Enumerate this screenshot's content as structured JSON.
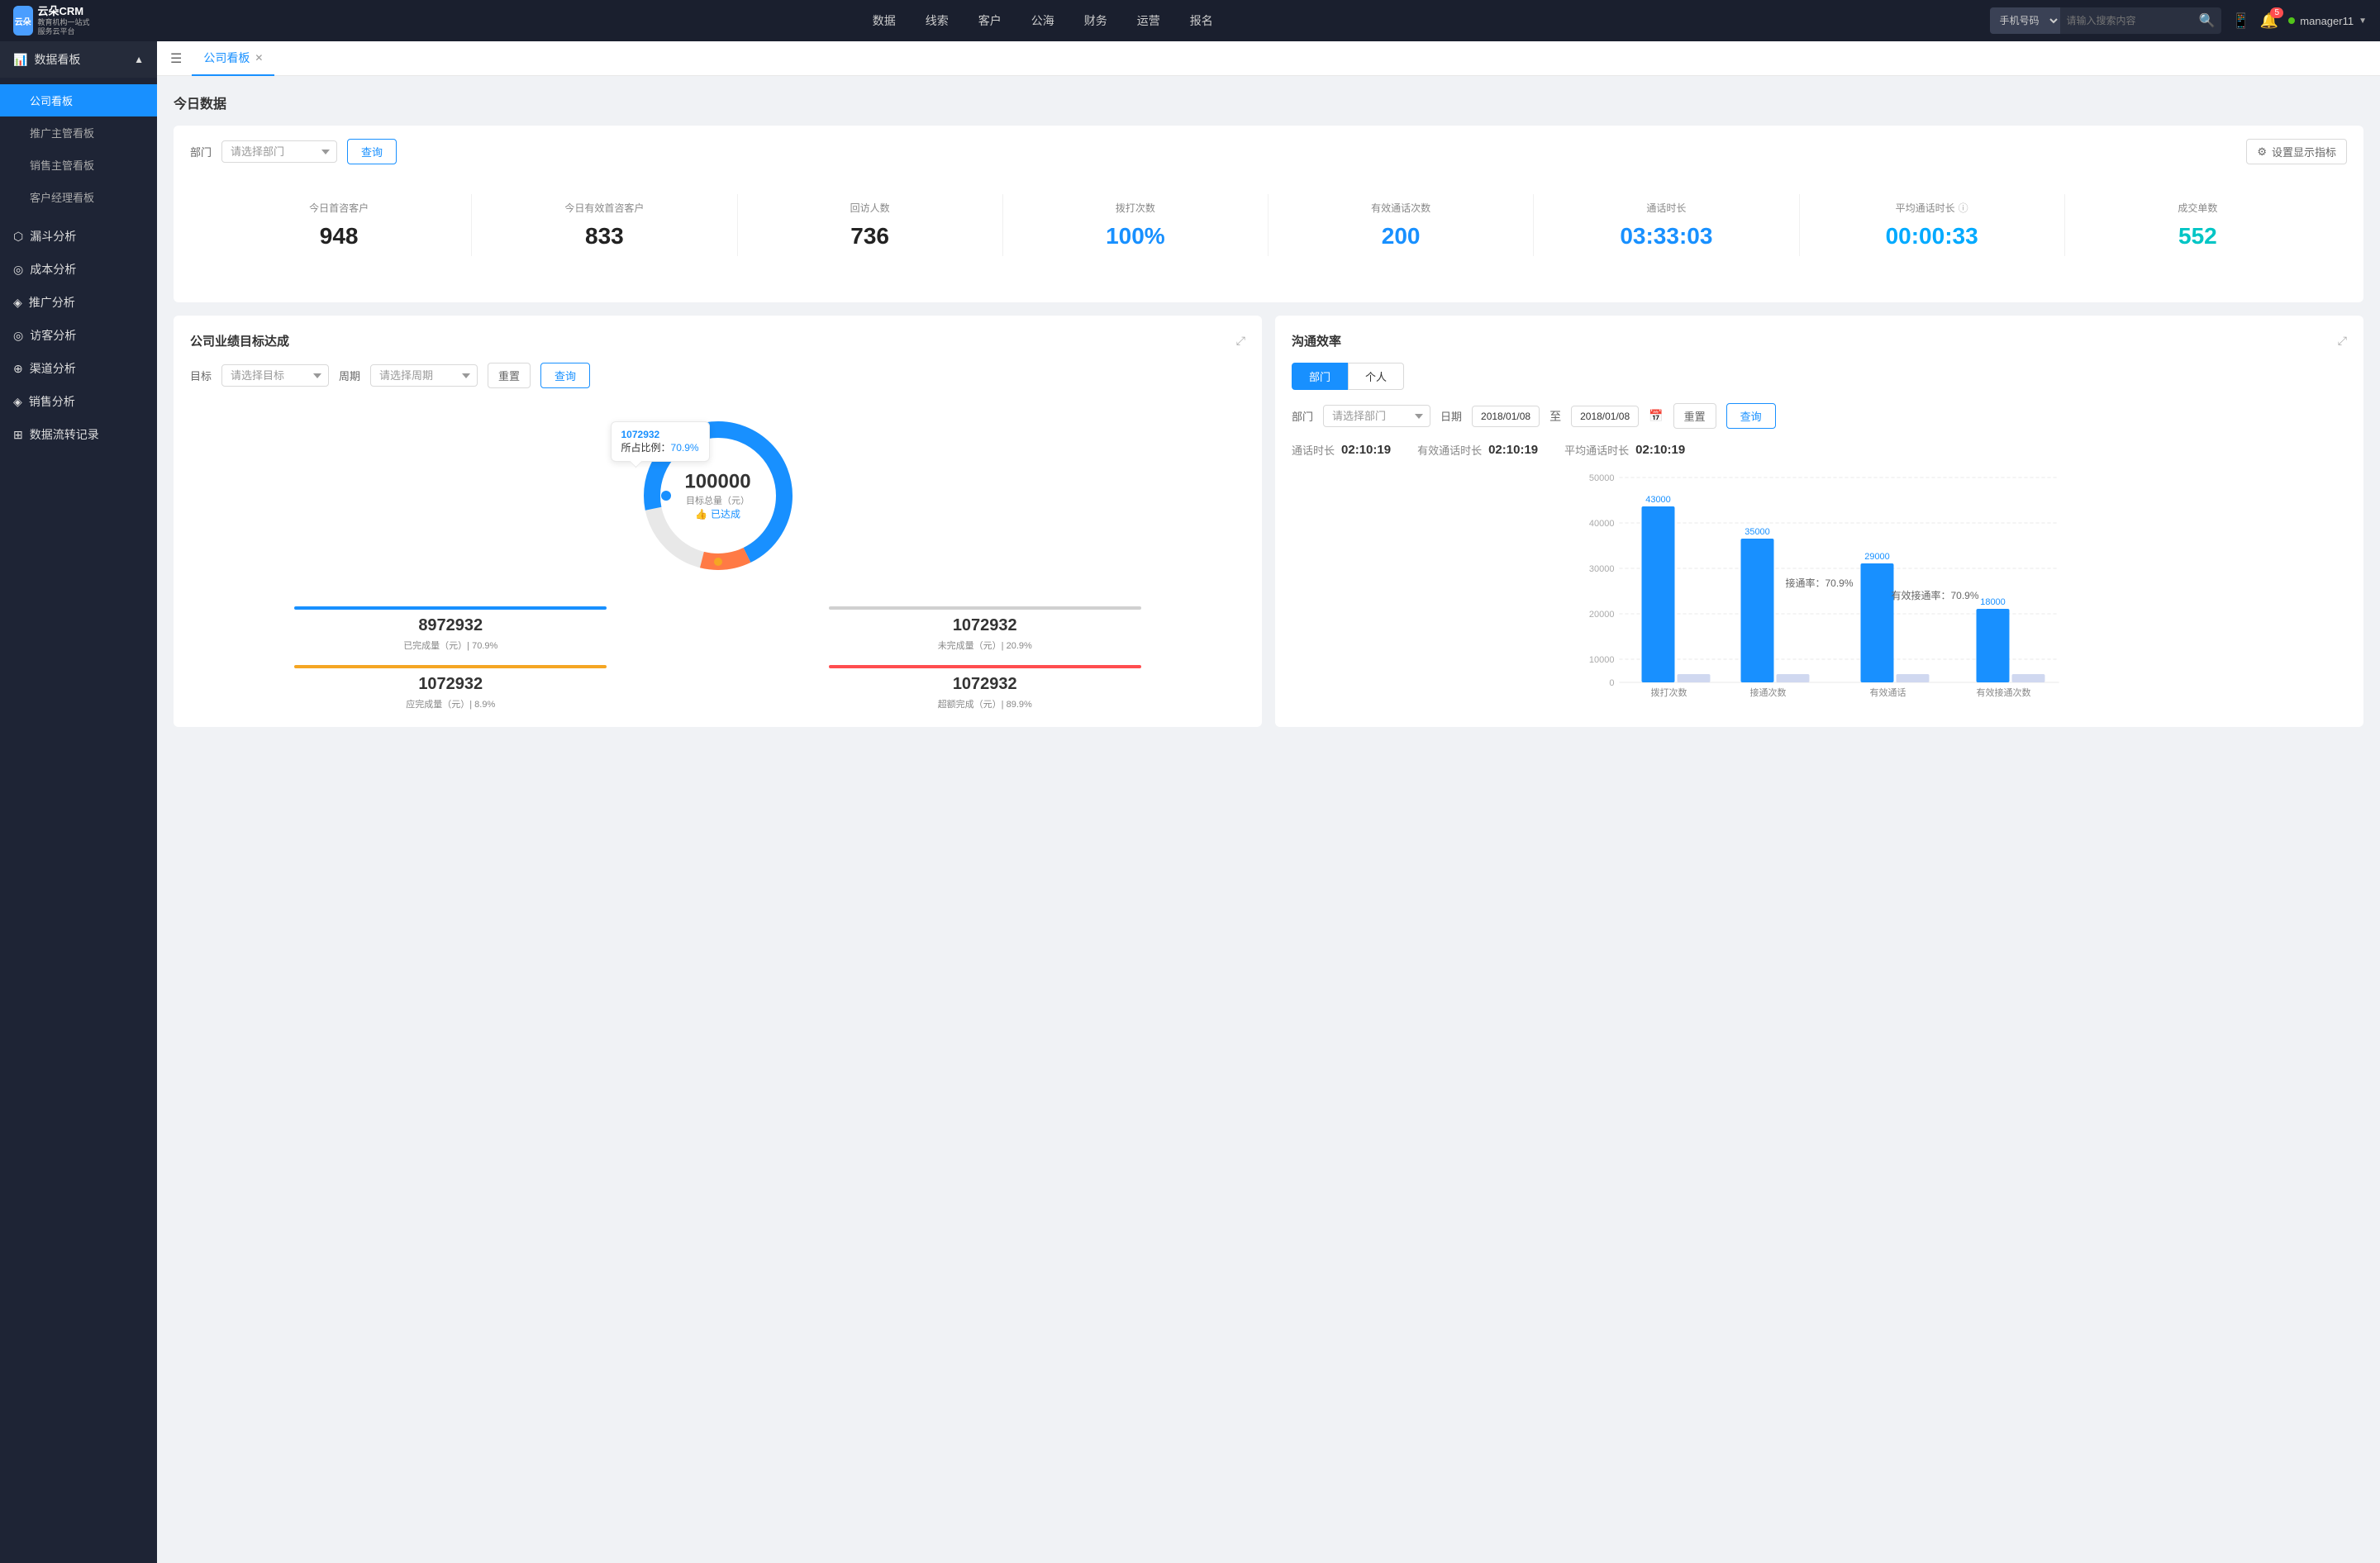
{
  "app": {
    "name": "云朵CRM",
    "subtitle": "教育机构一站式服务云平台"
  },
  "topnav": {
    "items": [
      "数据",
      "线索",
      "客户",
      "公海",
      "财务",
      "运营",
      "报名"
    ],
    "search": {
      "placeholder": "请输入搜索内容",
      "select_label": "手机号码"
    },
    "notification_count": "5",
    "username": "manager11"
  },
  "sidebar": {
    "dashboard_group": "数据看板",
    "items": [
      {
        "label": "公司看板",
        "active": true
      },
      {
        "label": "推广主管看板",
        "active": false
      },
      {
        "label": "销售主管看板",
        "active": false
      },
      {
        "label": "客户经理看板",
        "active": false
      }
    ],
    "groups": [
      {
        "label": "漏斗分析",
        "icon": "funnel"
      },
      {
        "label": "成本分析",
        "icon": "cost"
      },
      {
        "label": "推广分析",
        "icon": "promotion"
      },
      {
        "label": "访客分析",
        "icon": "visitor"
      },
      {
        "label": "渠道分析",
        "icon": "channel"
      },
      {
        "label": "销售分析",
        "icon": "sales"
      },
      {
        "label": "数据流转记录",
        "icon": "record"
      }
    ]
  },
  "tab": {
    "label": "公司看板"
  },
  "page": {
    "title": "今日数据",
    "dept_label": "部门",
    "dept_placeholder": "请选择部门",
    "query_btn": "查询",
    "settings_btn": "设置显示指标"
  },
  "stats": [
    {
      "label": "今日首咨客户",
      "value": "948",
      "color": "dark"
    },
    {
      "label": "今日有效首咨客户",
      "value": "833",
      "color": "dark"
    },
    {
      "label": "回访人数",
      "value": "736",
      "color": "dark"
    },
    {
      "label": "拨打次数",
      "value": "100%",
      "color": "blue"
    },
    {
      "label": "有效通话次数",
      "value": "200",
      "color": "blue"
    },
    {
      "label": "通话时长",
      "value": "03:33:03",
      "color": "blue"
    },
    {
      "label": "平均通话时长",
      "value": "00:00:33",
      "color": "cyan"
    },
    {
      "label": "成交单数",
      "value": "552",
      "color": "teal"
    }
  ],
  "goal_chart": {
    "title": "公司业绩目标达成",
    "target_label": "目标",
    "target_placeholder": "请选择目标",
    "period_label": "周期",
    "period_placeholder": "请选择周期",
    "reset_btn": "重置",
    "query_btn": "查询",
    "center_value": "100000",
    "center_label": "目标总量（元）",
    "achieved_label": "已达成",
    "tooltip_value": "1072932",
    "tooltip_pct_label": "所占比例：",
    "tooltip_pct": "70.9%",
    "stat_boxes": [
      {
        "bar_color": "#1890ff",
        "value": "8972932",
        "desc": "已完成量（元）| 70.9%"
      },
      {
        "bar_color": "#d0d0d0",
        "value": "1072932",
        "desc": "未完成量（元）| 20.9%"
      },
      {
        "bar_color": "#f5a623",
        "value": "1072932",
        "desc": "应完成量（元）| 8.9%"
      },
      {
        "bar_color": "#ff4d4f",
        "value": "1072932",
        "desc": "超额完成（元）| 89.9%"
      }
    ]
  },
  "comm_chart": {
    "title": "沟通效率",
    "tabs": [
      "部门",
      "个人"
    ],
    "active_tab": "部门",
    "dept_label": "部门",
    "dept_placeholder": "请选择部门",
    "date_label": "日期",
    "date_start": "2018/01/08",
    "date_end": "2018/01/08",
    "reset_btn": "重置",
    "query_btn": "查询",
    "stats": [
      {
        "label": "通话时长",
        "value": "02:10:19"
      },
      {
        "label": "有效通话时长",
        "value": "02:10:19"
      },
      {
        "label": "平均通话时长",
        "value": "02:10:19"
      }
    ],
    "y_labels": [
      "50000",
      "40000",
      "30000",
      "20000",
      "10000",
      "0"
    ],
    "x_labels": [
      "拨打次数",
      "接通次数",
      "有效通话",
      "有效接通次数"
    ],
    "bars": [
      {
        "x_label": "拨打次数",
        "value1": 43000,
        "value2": 5000,
        "label1": "43000"
      },
      {
        "x_label": "接通次数",
        "value1": 35000,
        "value2": 4000,
        "label1": "35000",
        "pct_label": "接通率：70.9%"
      },
      {
        "x_label": "有效通话",
        "value1": 29000,
        "value2": 3000,
        "label1": "29000",
        "pct_label": "有效接通率：70.9%"
      },
      {
        "x_label": "有效接通次数",
        "value1": 18000,
        "value2": 2000,
        "label1": "18000"
      }
    ]
  }
}
